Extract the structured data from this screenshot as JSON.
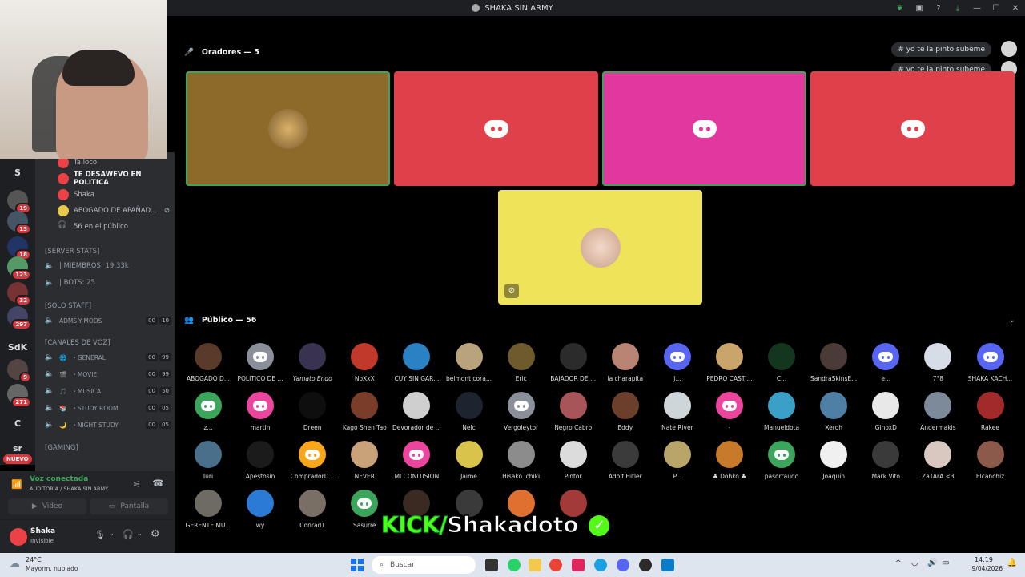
{
  "window": {
    "title": "SHAKA SIN ARMY"
  },
  "stage": {
    "speakers_header": "Oradores — 5",
    "audience_header": "Público — 56",
    "chips": [
      "# yo te la pinto subeme",
      "# yo te la pinto subeme"
    ],
    "speaker_tiles": [
      {
        "kind": "avatar",
        "bg": "#8b6a2a",
        "speaking": true
      },
      {
        "kind": "discord",
        "bg": "#e04049",
        "speaking": false
      },
      {
        "kind": "discord",
        "bg": "#e0389c",
        "speaking": true
      },
      {
        "kind": "discord",
        "bg": "#e04049",
        "speaking": false
      },
      {
        "kind": "avatar",
        "bg": "#efe35a",
        "speaking": false,
        "muted": true
      }
    ],
    "audience": [
      {
        "name": "ABOGADO D...",
        "color": "#5a3a2a",
        "type": "img"
      },
      {
        "name": "POLITICO DE ...",
        "color": "#8a8f99",
        "type": "discord"
      },
      {
        "name": "Yamato Endo",
        "color": "#3a3350",
        "type": "img"
      },
      {
        "name": "NoXxX",
        "color": "#c0392b",
        "type": "img"
      },
      {
        "name": "CUY SIN GAR...",
        "color": "#2a82c4",
        "type": "img"
      },
      {
        "name": "belmont cora...",
        "color": "#b9a37d",
        "type": "img"
      },
      {
        "name": "Eric",
        "color": "#6d5a2d",
        "type": "img"
      },
      {
        "name": "BAJADOR DE ...",
        "color": "#2b2b2b",
        "type": "img"
      },
      {
        "name": "la charapita",
        "color": "#b98473",
        "type": "img"
      },
      {
        "name": "j...",
        "color": "#5865f2",
        "type": "discord"
      },
      {
        "name": "PEDRO CASTI...",
        "color": "#caa56b",
        "type": "img"
      },
      {
        "name": "C...",
        "color": "#14361e",
        "type": "img"
      },
      {
        "name": "SandraSkinsE...",
        "color": "#4a3b36",
        "type": "img"
      },
      {
        "name": "e...",
        "color": "#5865f2",
        "type": "discord"
      },
      {
        "name": "7°8",
        "color": "#d7dde6",
        "type": "img"
      },
      {
        "name": "SHAKA KACH...",
        "color": "#5865f2",
        "type": "discord"
      },
      {
        "name": "z...",
        "color": "#3ba55c",
        "type": "discord"
      },
      {
        "name": "martin",
        "color": "#eb459e",
        "type": "discord"
      },
      {
        "name": "Dreen",
        "color": "#0e0e0e",
        "type": "img"
      },
      {
        "name": "Kago Shen Tao",
        "color": "#7a3d2a",
        "type": "img"
      },
      {
        "name": "Devorador de ...",
        "color": "#cfcfcf",
        "type": "img"
      },
      {
        "name": "Nelc",
        "color": "#1e2330",
        "type": "img"
      },
      {
        "name": "Vergoleytor",
        "color": "#8a8f99",
        "type": "discord"
      },
      {
        "name": "Negro Cabro",
        "color": "#a8555a",
        "type": "img"
      },
      {
        "name": "Eddy",
        "color": "#6c3f2c",
        "type": "img"
      },
      {
        "name": "Nate River",
        "color": "#cfd6da",
        "type": "img"
      },
      {
        "name": "-",
        "color": "#eb459e",
        "type": "discord"
      },
      {
        "name": "Manueldota",
        "color": "#3aa0c8",
        "type": "img"
      },
      {
        "name": "Xeroh",
        "color": "#4f7fa4",
        "type": "img"
      },
      {
        "name": "GinoxD",
        "color": "#e8e8e8",
        "type": "img"
      },
      {
        "name": "Andermakis",
        "color": "#7d8a99",
        "type": "img"
      },
      {
        "name": "Rakee",
        "color": "#a32a2a",
        "type": "img"
      },
      {
        "name": "Iuri",
        "color": "#4a6f8a",
        "type": "img"
      },
      {
        "name": "Apestosin",
        "color": "#1b1b1b",
        "type": "img"
      },
      {
        "name": "CompradorD...",
        "color": "#faa61a",
        "type": "discord"
      },
      {
        "name": "NEVER",
        "color": "#caa27a",
        "type": "img"
      },
      {
        "name": "MI CONLUSION",
        "color": "#eb459e",
        "type": "discord"
      },
      {
        "name": "Jaime",
        "color": "#d9c34a",
        "type": "img"
      },
      {
        "name": "Hisako Ichiki",
        "color": "#8c8c8c",
        "type": "img"
      },
      {
        "name": "Pintor",
        "color": "#dcdcdc",
        "type": "img"
      },
      {
        "name": "Adolf Hitler",
        "color": "#3b3b3b",
        "type": "img"
      },
      {
        "name": "P...",
        "color": "#b9a56a",
        "type": "img"
      },
      {
        "name": "♣ Dohko ♣",
        "color": "#c77a2a",
        "type": "img"
      },
      {
        "name": "pasorraudo",
        "color": "#3ba55c",
        "type": "discord"
      },
      {
        "name": "Joaquín",
        "color": "#f0f0f0",
        "type": "img"
      },
      {
        "name": "Mark Vito",
        "color": "#3a3a3a",
        "type": "img"
      },
      {
        "name": "ZaTArA <3",
        "color": "#d8c8c0",
        "type": "img"
      },
      {
        "name": "Elcanchiz",
        "color": "#8c5a4a",
        "type": "img"
      },
      {
        "name": "GERENTE MU...",
        "color": "#6e6a64",
        "type": "img"
      },
      {
        "name": "wy",
        "color": "#2a7ad6",
        "type": "img"
      },
      {
        "name": "Conrad1",
        "color": "#7a6f64",
        "type": "img"
      },
      {
        "name": "Sasurre",
        "color": "#3ba55c",
        "type": "discord"
      },
      {
        "name": "",
        "color": "#3a2a22",
        "type": "img"
      },
      {
        "name": "",
        "color": "#3a3a3a",
        "type": "img"
      },
      {
        "name": "",
        "color": "#e07030",
        "type": "img"
      },
      {
        "name": "",
        "color": "#a33a3a",
        "type": "img"
      }
    ]
  },
  "sidebar": {
    "voice_users": [
      {
        "name": "Ta loco",
        "bold": false
      },
      {
        "name": "TE DESAWEVO EN POLITICA",
        "bold": true
      },
      {
        "name": "Shaka",
        "bold": false
      },
      {
        "name": "ABOGADO DE APAÑAD...",
        "bold": false
      },
      {
        "name": "56 en el público",
        "bold": false
      }
    ],
    "cat_stats": "[SERVER STATS]",
    "stat_members": "| MIEMBROS: 19.33k",
    "stat_bots": "| BOTS: 25",
    "cat_staff": "[SOLO STAFF]",
    "ch_adms": "ADMS-Y-MODS",
    "ch_adms_counts": [
      "00",
      "10"
    ],
    "cat_voz": "[CANALES DE VOZ]",
    "voice_channels": [
      {
        "name": "GENERAL",
        "counts": [
          "00",
          "99"
        ]
      },
      {
        "name": "MOVIE",
        "counts": [
          "00",
          "99"
        ]
      },
      {
        "name": "MUSICA",
        "counts": [
          "00",
          "50"
        ]
      },
      {
        "name": "STUDY ROOM",
        "counts": [
          "00",
          "05"
        ]
      },
      {
        "name": "NIGHT STUDY",
        "counts": [
          "00",
          "05"
        ]
      }
    ],
    "cat_gaming": "[GAMING]"
  },
  "servers": [
    {
      "label": "S",
      "badge": ""
    },
    {
      "label": "",
      "badge": "19"
    },
    {
      "label": "",
      "badge": "13"
    },
    {
      "label": "",
      "badge": "18"
    },
    {
      "label": "",
      "badge": "123"
    },
    {
      "label": "",
      "badge": "32"
    },
    {
      "label": "",
      "badge": "297"
    },
    {
      "label": "SdK",
      "badge": ""
    },
    {
      "label": "",
      "badge": "9"
    },
    {
      "label": "",
      "badge": "271"
    },
    {
      "label": "C",
      "badge": ""
    },
    {
      "label": "sr",
      "badge": ""
    }
  ],
  "nuevo_label": "NUEVO",
  "voice_panel": {
    "status": "Voz conectada",
    "channel": "AUDITORIA / SHAKA SIN ARMY",
    "video": "Video",
    "screen": "Pantalla"
  },
  "user_panel": {
    "name": "Shaka",
    "status": "Invisible"
  },
  "overlay": {
    "kick": "KICK/",
    "handle": "Shakadoto"
  },
  "taskbar": {
    "weather_temp": "24°C",
    "weather_desc": "Mayorm. nublado",
    "search": "Buscar",
    "time": "14:19",
    "date": "9/04/2026"
  }
}
